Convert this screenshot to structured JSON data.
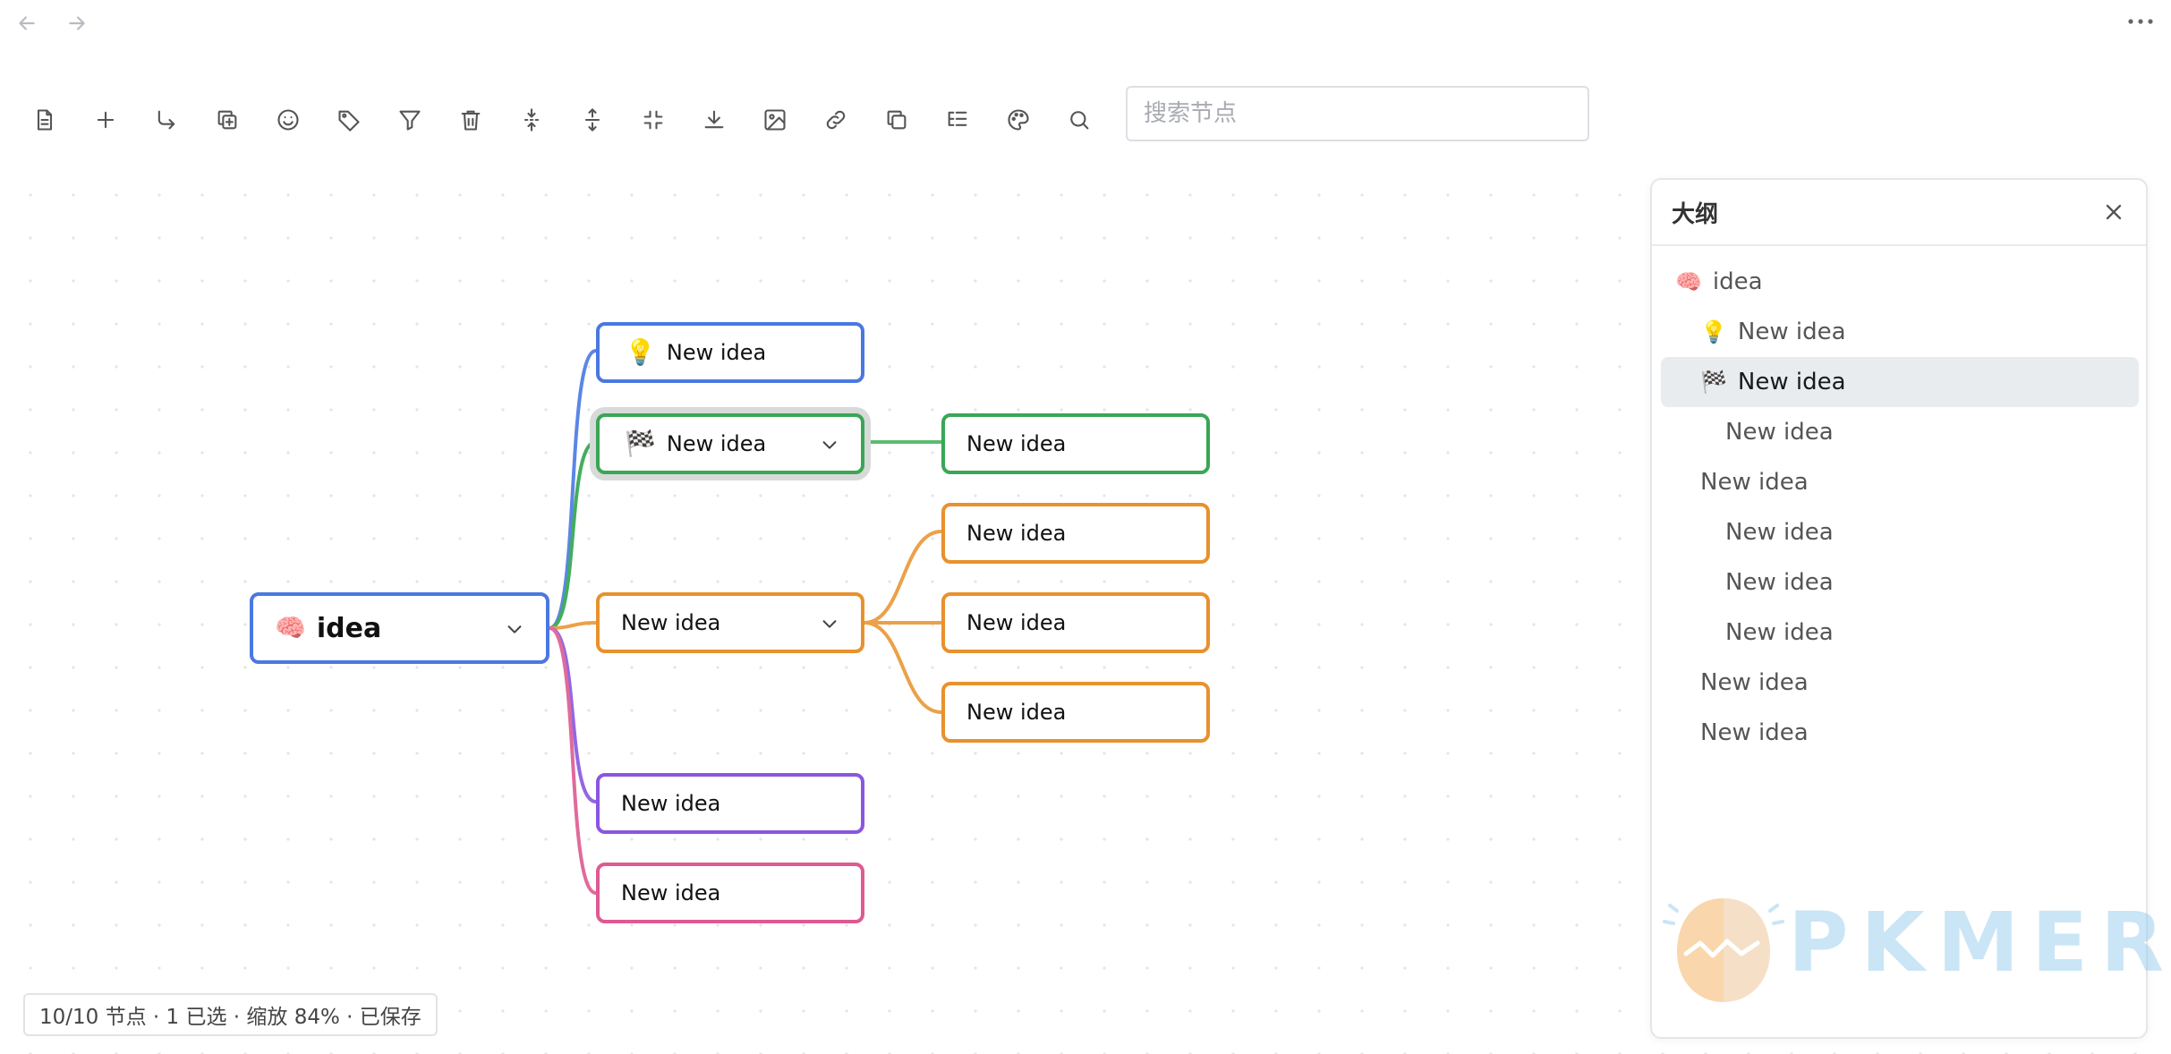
{
  "nav": {
    "back_icon": "arrow-left-icon",
    "forward_icon": "arrow-right-icon",
    "more_icon": "more-horizontal-icon"
  },
  "toolbar": {
    "tools": [
      "document-icon",
      "add-icon",
      "add-child-icon",
      "duplicate-icon",
      "emoji-icon",
      "tag-icon",
      "filter-icon",
      "delete-icon",
      "expand-vertical-icon",
      "collapse-vertical-icon",
      "compress-icon",
      "download-icon",
      "image-icon",
      "link-icon",
      "copy-icon",
      "list-tree-icon",
      "palette-icon",
      "search-icon"
    ],
    "search_placeholder": "搜索节点"
  },
  "mindmap": {
    "root": {
      "emoji": "🧠",
      "label": "idea",
      "color": "#4a78e0"
    },
    "nodes": [
      {
        "emoji": "💡",
        "label": "New idea",
        "color": "#4a78e0"
      },
      {
        "emoji": "🏁",
        "label": "New idea",
        "color": "#3aa655",
        "selected": true
      },
      {
        "emoji": "",
        "label": "New idea",
        "color": "#3aa655"
      },
      {
        "emoji": "",
        "label": "New idea",
        "color": "#e8912d"
      },
      {
        "emoji": "",
        "label": "New idea",
        "color": "#e8912d"
      },
      {
        "emoji": "",
        "label": "New idea",
        "color": "#e8912d"
      },
      {
        "emoji": "",
        "label": "New idea",
        "color": "#e8912d"
      },
      {
        "emoji": "",
        "label": "New idea",
        "color": "#8a56e0"
      },
      {
        "emoji": "",
        "label": "New idea",
        "color": "#de5a91"
      }
    ]
  },
  "outline": {
    "title": "大纲",
    "close_icon": "close-icon",
    "items": [
      {
        "emoji": "🧠",
        "label": "idea",
        "level": 0
      },
      {
        "emoji": "💡",
        "label": "New idea",
        "level": 1
      },
      {
        "emoji": "🏁",
        "label": "New idea",
        "level": 1,
        "active": true
      },
      {
        "emoji": "",
        "label": "New idea",
        "level": 2
      },
      {
        "emoji": "",
        "label": "New idea",
        "level": 1
      },
      {
        "emoji": "",
        "label": "New idea",
        "level": 2
      },
      {
        "emoji": "",
        "label": "New idea",
        "level": 2
      },
      {
        "emoji": "",
        "label": "New idea",
        "level": 2
      },
      {
        "emoji": "",
        "label": "New idea",
        "level": 1
      },
      {
        "emoji": "",
        "label": "New idea",
        "level": 1
      }
    ]
  },
  "watermark": {
    "text": "PKMER"
  },
  "status": {
    "text": "10/10 节点 · 1 已选 · 缩放 84% · 已保存"
  }
}
